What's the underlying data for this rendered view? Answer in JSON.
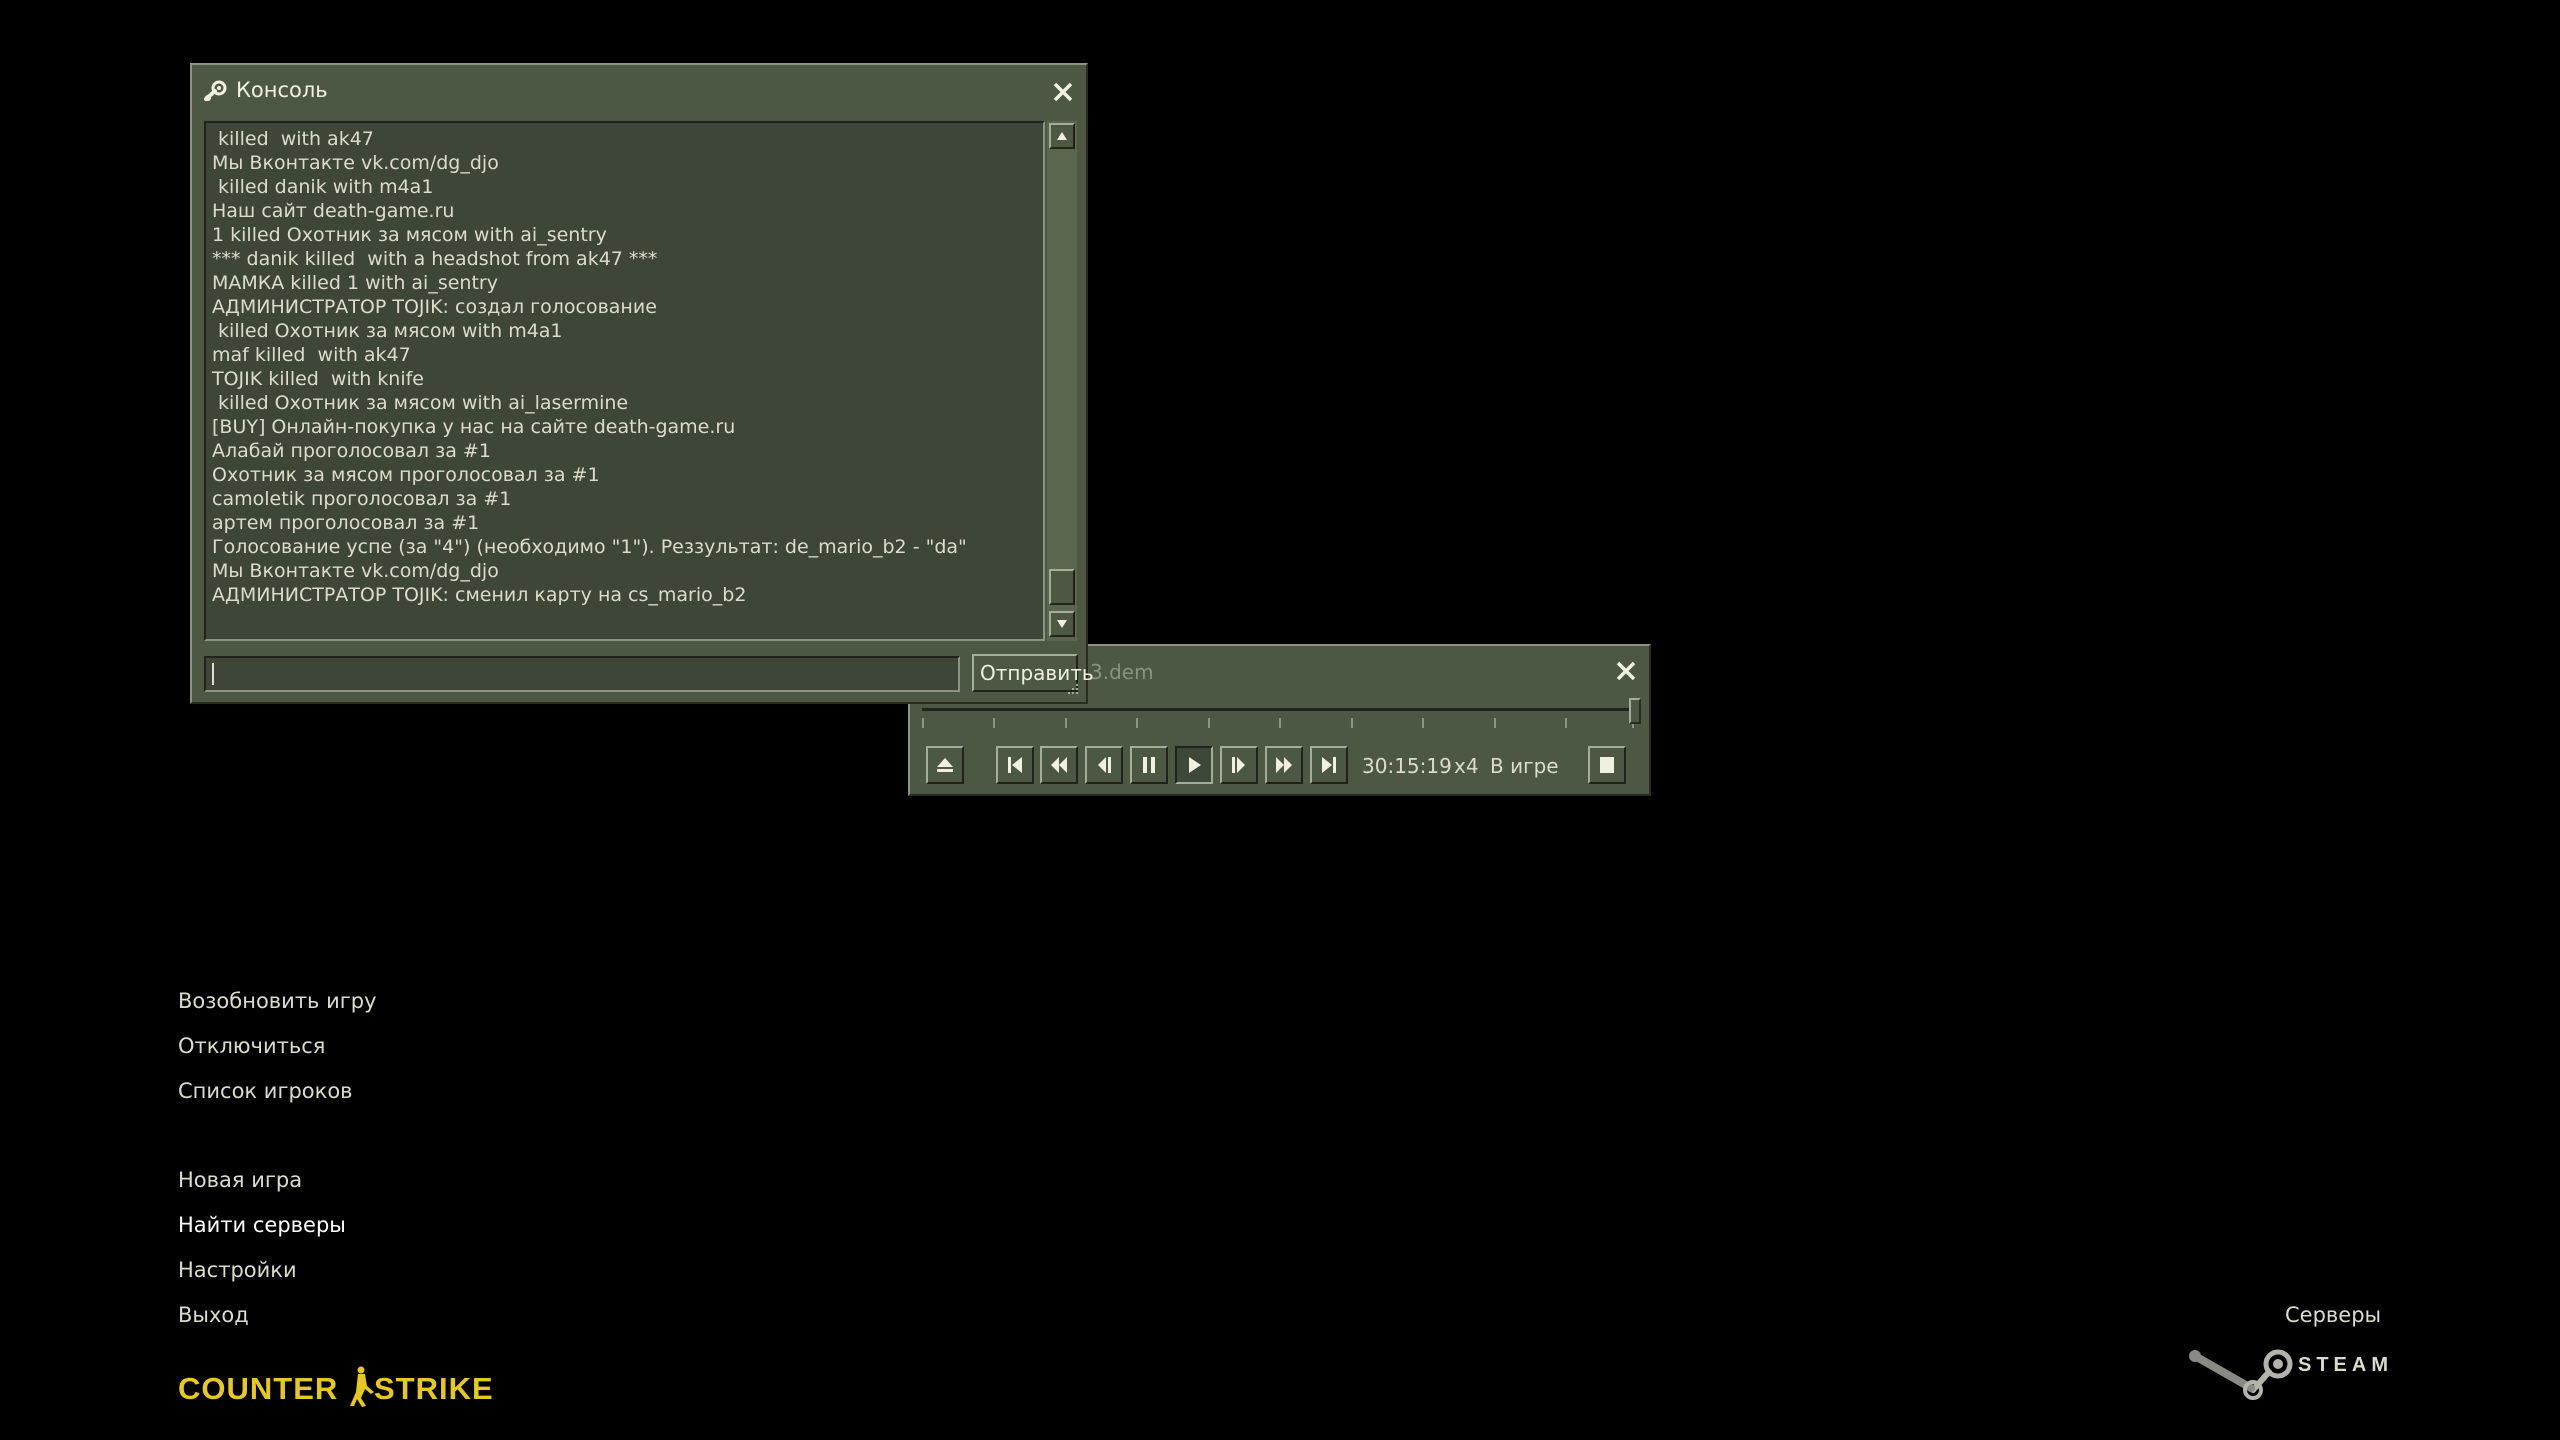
{
  "console": {
    "title": "Консоль",
    "lines": [
      " killed  with ak47",
      "Мы Вконтакте vk.com/dg_djo",
      " killed danik with m4a1",
      "Наш сайт death-game.ru",
      "1 killed Охотник за мясом with ai_sentry",
      "*** danik killed  with a headshot from ak47 ***",
      "МАМКА killed 1 with ai_sentry",
      "АДМИНИСТРАТОР TOJIK: создал голосование",
      " killed Охотник за мясом with m4a1",
      "maf killed  with ak47",
      "TOJIK killed  with knife",
      " killed Охотник за мясом with ai_lasermine",
      "[BUY] Онлайн-покупка у нас на сайте death-game.ru",
      "Алабай проголосовал за #1",
      "Охотник за мясом проголосовал за #1",
      "camoletik проголосовал за #1",
      "артем проголосовал за #1",
      "Голосование успе (за \"4\") (необходимо \"1\"). Реззультат: de_mario_b2 - \"da\"",
      "Мы Вконтакте vk.com/dg_djo",
      "АДМИНИСТРАТОР TOJIK: сменил карту на cs_mario_b2"
    ],
    "input_value": "",
    "send_label": "Отправить"
  },
  "demo_player": {
    "title": "3.dem",
    "time": "30:15:19",
    "speed": "x4",
    "status": "В игре",
    "buttons": [
      "eject-icon",
      "skip-start-icon",
      "rewind-icon",
      "step-back-icon",
      "pause-icon",
      "play-icon",
      "step-forward-icon",
      "fast-forward-icon",
      "skip-end-icon",
      "stop-icon"
    ],
    "progress": 1.0
  },
  "menu": {
    "resume": "Возобновить игру",
    "disconnect": "Отключиться",
    "players": "Список игроков",
    "new_game": "Новая игра",
    "find_servers": "Найти серверы",
    "settings": "Настройки",
    "quit": "Выход"
  },
  "footer": {
    "servers": "Серверы",
    "steam": "STEAM",
    "logo": "Counter-Strike"
  },
  "colors": {
    "panel": "#4c5844",
    "panel_dark": "#3e4637",
    "logo_yellow": "#e6c81e",
    "text": "#dcdccc"
  }
}
